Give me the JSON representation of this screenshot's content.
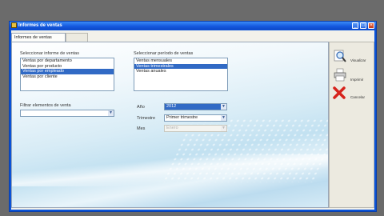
{
  "window": {
    "title": "Informes de ventas",
    "controls": {
      "minimize": "_",
      "maximize": "□",
      "close": "×"
    }
  },
  "tabs": [
    {
      "label": "Informes de ventas"
    }
  ],
  "report": {
    "label": "Seleccionar informe de ventas",
    "items": [
      "Ventas por departamento",
      "Ventas por producto",
      "Ventas por empleado",
      "Ventas por cliente"
    ],
    "selected_index": 2
  },
  "period": {
    "label": "Seleccionar período de ventas",
    "items": [
      "Ventas mensuales",
      "Ventas trimestrales",
      "Ventas anuales"
    ],
    "selected_index": 1
  },
  "filter": {
    "label": "Filtrar elementos de venta",
    "value": ""
  },
  "year": {
    "label": "Año",
    "value": "2012"
  },
  "quarter": {
    "label": "Trimestre",
    "value": "Primer trimestre"
  },
  "month": {
    "label": "Mes",
    "value": "Enero",
    "disabled": true
  },
  "actions": [
    {
      "label": "Visualizar",
      "icon": "magnifier-icon"
    },
    {
      "label": "Imprimir",
      "icon": "printer-icon"
    },
    {
      "label": "Cancelar",
      "icon": "red-x-icon"
    }
  ],
  "colors": {
    "titlebar": "#0a53d8",
    "selection": "#316ac5",
    "cancel": "#d6231b"
  }
}
